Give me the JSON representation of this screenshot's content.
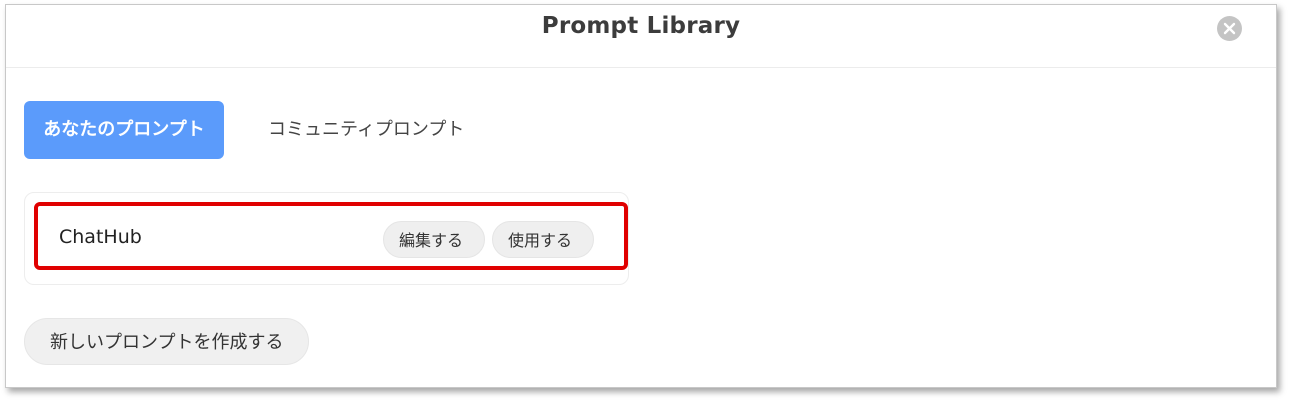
{
  "dialog": {
    "title": "Prompt Library"
  },
  "tabs": [
    {
      "label": "あなたのプロンプト",
      "active": true
    },
    {
      "label": "コミュニティプロンプト",
      "active": false
    }
  ],
  "prompts": [
    {
      "name": "ChatHub",
      "edit_label": "編集する",
      "use_label": "使用する"
    }
  ],
  "actions": {
    "new_prompt_label": "新しいプロンプトを作成する"
  },
  "icons": {
    "close": "close-icon"
  },
  "colors": {
    "accent": "#5b9bfb",
    "highlight": "#e00000"
  }
}
